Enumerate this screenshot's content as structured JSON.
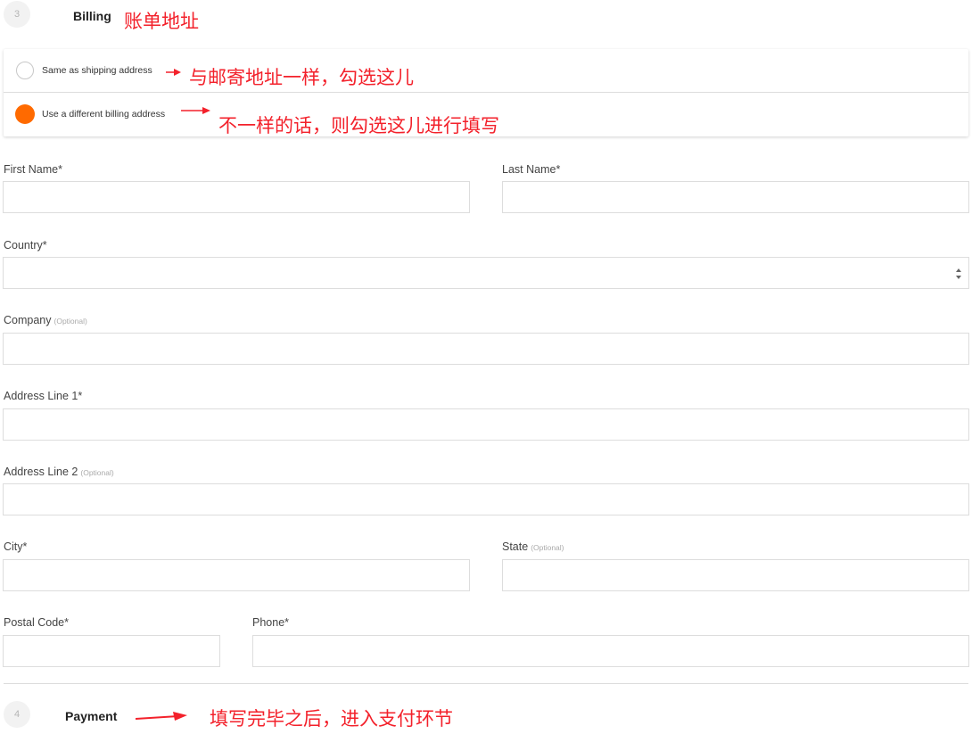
{
  "billing": {
    "step_number": "3",
    "title": "Billing",
    "annotation": "账单地址",
    "options": [
      {
        "label": "Same as shipping address",
        "annotation": "与邮寄地址一样，勾选这儿",
        "checked": false
      },
      {
        "label": "Use a different billing address",
        "annotation": "不一样的话，则勾选这儿进行填写",
        "checked": true
      }
    ]
  },
  "form": {
    "first_name": {
      "label": "First Name*",
      "value": ""
    },
    "last_name": {
      "label": "Last Name*",
      "value": ""
    },
    "country": {
      "label": "Country*",
      "value": ""
    },
    "company": {
      "label": "Company",
      "optional": "(Optional)",
      "value": ""
    },
    "address1": {
      "label": "Address Line 1*",
      "value": ""
    },
    "address2": {
      "label": "Address Line 2",
      "optional": "(Optional)",
      "value": ""
    },
    "city": {
      "label": "City*",
      "value": ""
    },
    "state": {
      "label": "State",
      "optional": "(Optional)",
      "value": ""
    },
    "postal_code": {
      "label": "Postal Code*",
      "value": ""
    },
    "phone": {
      "label": "Phone*",
      "value": ""
    }
  },
  "payment": {
    "step_number": "4",
    "title": "Payment",
    "annotation": "填写完毕之后，进入支付环节"
  },
  "colors": {
    "accent": "#ff6a00",
    "annotation": "#f3212b",
    "border": "#dddddd"
  }
}
